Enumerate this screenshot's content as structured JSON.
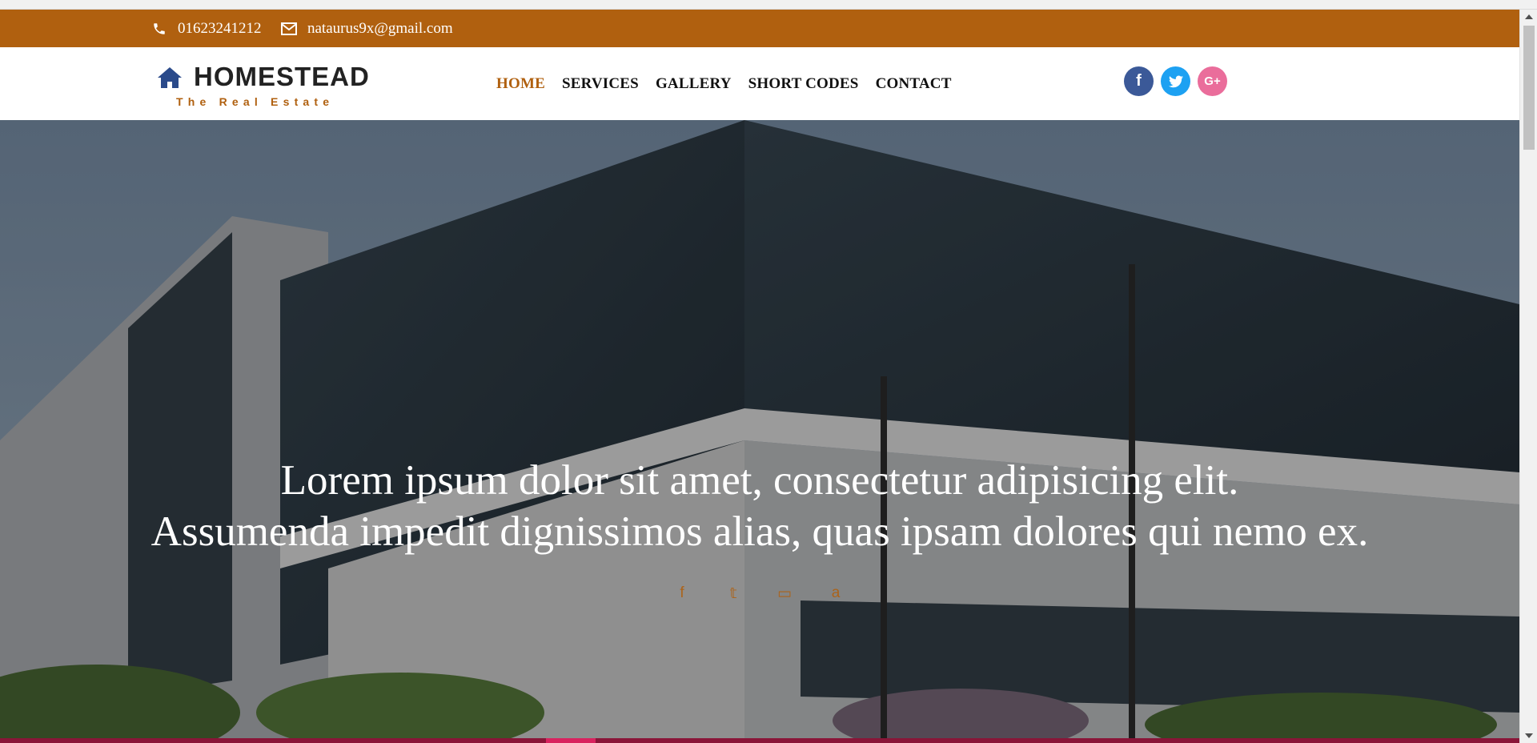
{
  "topbar": {
    "phone": "01623241212",
    "email": "nataurus9x@gmail.com",
    "background": "#b0600f"
  },
  "logo": {
    "brand": "HOMESTEAD",
    "tagline": "The Real Estate",
    "icon": "house-icon"
  },
  "nav": {
    "items": [
      {
        "label": "HOME",
        "active": true
      },
      {
        "label": "SERVICES"
      },
      {
        "label": "GALLERY"
      },
      {
        "label": "SHORT CODES"
      },
      {
        "label": "CONTACT"
      }
    ]
  },
  "social": {
    "facebook": "f",
    "twitter": "t",
    "googleplus": "G+"
  },
  "hero": {
    "line1": "Lorem ipsum dolor sit amet, consectetur adipisicing elit.",
    "line2": "Assumenda impedit dignissimos alias, quas ipsam dolores qui nemo ex.",
    "icons": [
      "facebook-icon",
      "twitter-icon",
      "twitch-icon",
      "amazon-icon"
    ],
    "icon_glyphs": [
      "f",
      "𝕥",
      "▭",
      "a"
    ]
  },
  "colors": {
    "accent": "#b0600f",
    "text": "#111111",
    "facebook": "#3b5998",
    "twitter": "#1da1f2",
    "googleplus": "#ea6d9b"
  }
}
